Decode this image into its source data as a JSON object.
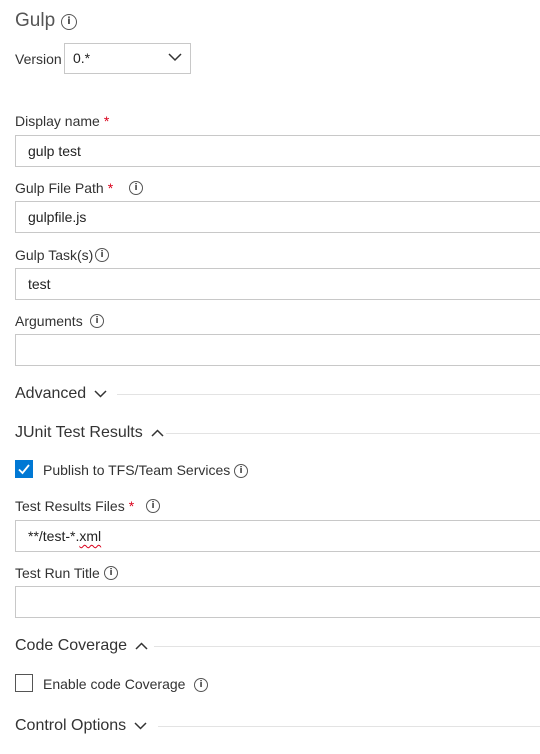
{
  "header": {
    "title": "Gulp"
  },
  "version": {
    "label": "Version",
    "value": "0.*"
  },
  "display_name": {
    "label": "Display name",
    "required": "*",
    "value": "gulp test"
  },
  "gulp_file_path": {
    "label": "Gulp File Path",
    "required": "*",
    "value": "gulpfile.js"
  },
  "gulp_tasks": {
    "label": "Gulp Task(s)",
    "value": "test"
  },
  "arguments": {
    "label": "Arguments",
    "value": ""
  },
  "advanced": {
    "label": "Advanced"
  },
  "junit": {
    "label": "JUnit Test Results",
    "publish_label": "Publish to TFS/Team Services",
    "publish_checked": true,
    "results_files_label": "Test Results Files",
    "results_files_required": "*",
    "results_files_prefix": "**/test-*.",
    "results_files_suffix": "xml",
    "run_title_label": "Test Run Title",
    "run_title_value": ""
  },
  "code_coverage": {
    "label": "Code Coverage",
    "enable_label": "Enable code Coverage",
    "enable_checked": false
  },
  "control_options": {
    "label": "Control Options"
  },
  "colors": {
    "accent": "#0078d4",
    "required": "#d9001b",
    "border": "#c8c8c8"
  }
}
